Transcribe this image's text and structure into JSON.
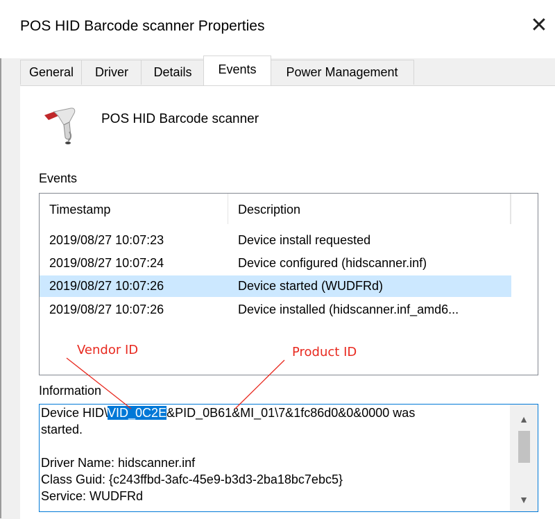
{
  "window": {
    "title": "POS HID Barcode scanner Properties",
    "close_glyph": "✕"
  },
  "tabs": [
    {
      "label": "General"
    },
    {
      "label": "Driver"
    },
    {
      "label": "Details"
    },
    {
      "label": "Events",
      "active": true
    },
    {
      "label": "Power Management"
    }
  ],
  "device": {
    "name": "POS HID Barcode scanner",
    "icon": "barcode-scanner-icon"
  },
  "events": {
    "label": "Events",
    "columns": [
      "Timestamp",
      "Description"
    ],
    "rows": [
      {
        "timestamp": "2019/08/27 10:07:23",
        "description": "Device install requested"
      },
      {
        "timestamp": "2019/08/27 10:07:24",
        "description": "Device configured (hidscanner.inf)"
      },
      {
        "timestamp": "2019/08/27 10:07:26",
        "description": "Device started (WUDFRd)",
        "selected": true
      },
      {
        "timestamp": "2019/08/27 10:07:26",
        "description": "Device installed (hidscanner.inf_amd6..."
      }
    ]
  },
  "annotations": {
    "vendor_id": "Vendor ID",
    "product_id": "Product ID",
    "color": "#e8291f"
  },
  "information": {
    "label": "Information",
    "line1_prefix": "Device HID\\",
    "line1_highlight": "VID_0C2E",
    "line1_suffix": "&PID_0B61&MI_01\\7&1fc86d0&0&0000 was",
    "line2": "started.",
    "line3": "",
    "line4": "Driver Name: hidscanner.inf",
    "line5": "Class Guid: {c243ffbd-3afc-45e9-b3d3-2ba18bc7ebc5}",
    "line6": "Service: WUDFRd"
  },
  "colors": {
    "selection": "#cce8ff",
    "highlight": "#0078d7",
    "focus_border": "#0078d7"
  }
}
